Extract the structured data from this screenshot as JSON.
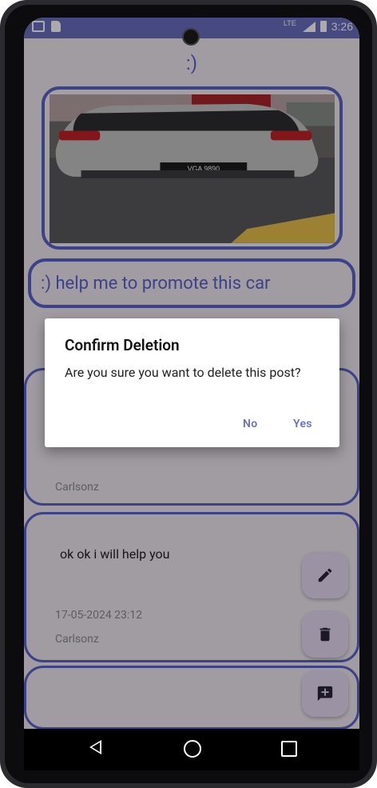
{
  "status_bar": {
    "time": "3:26",
    "network": "LTE"
  },
  "screen": {
    "top_label": ":)",
    "post_text": ":) help me to promote this car",
    "comments": [
      {
        "user": "Carlsonz"
      },
      {
        "text": "ok ok i will help you",
        "date": "17-05-2024 23:12",
        "user": "Carlsonz"
      }
    ]
  },
  "dialog": {
    "title": "Confirm Deletion",
    "message": "Are you sure you want to delete this post?",
    "no_label": "No",
    "yes_label": "Yes"
  },
  "fabs": {
    "edit_icon": "edit-icon",
    "delete_icon": "delete-icon",
    "add_comment_icon": "add-comment-icon"
  },
  "colors": {
    "accent": "#5b61c9",
    "status_bar": "#6b6fc1",
    "fab_bg": "#e7dcf5"
  }
}
